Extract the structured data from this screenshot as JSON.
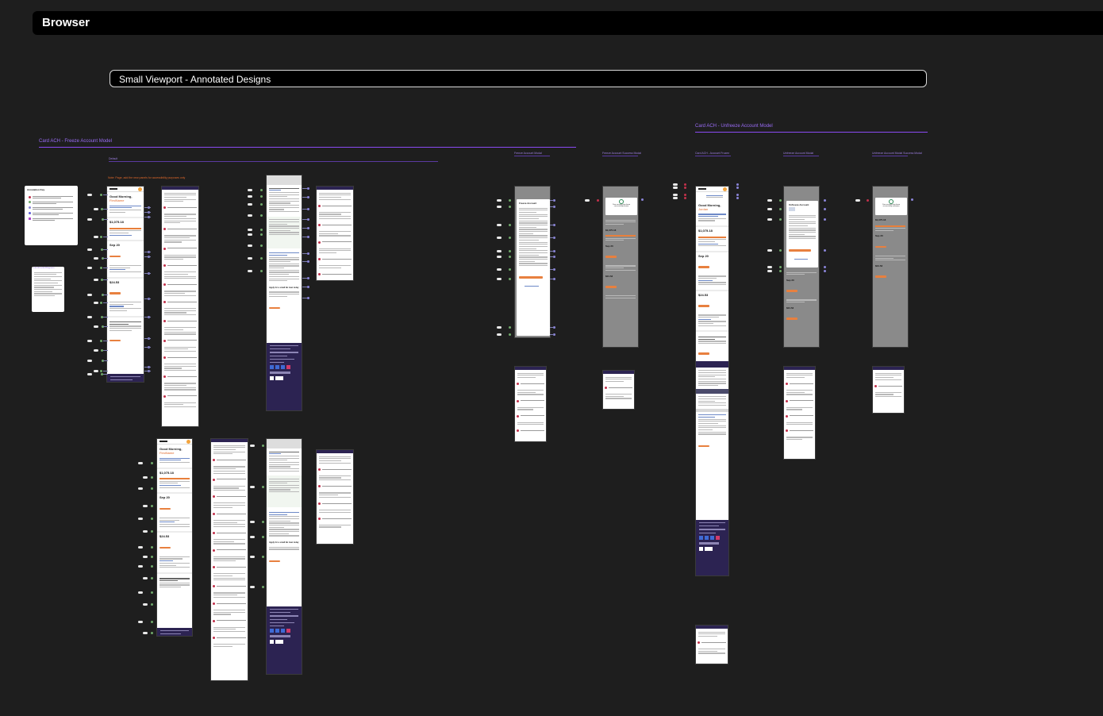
{
  "window": {
    "title": "Browser"
  },
  "section": {
    "title": "Small Viewport - Annotated Designs"
  },
  "groups": {
    "freeze": {
      "label": "Card ACH - Freeze Account Model"
    },
    "unfreeze": {
      "label": "Card ACH - Unfreeze Account Model"
    }
  },
  "subgroups": {
    "default": "Default",
    "freeze_account": "Freeze Account Modal",
    "freeze_success": "Freeze Account Success Modal",
    "unfreeze_frozen": "Card ACH - Account Frozen",
    "unfreeze_modal": "Unfreeze Account Modal",
    "unfreeze_success": "Unfreeze Account Modal Success Modal"
  },
  "notes": {
    "orange": "Note: Page, add the new panels for accessibility purposes only",
    "legend_title": "Annotation Key",
    "landmarks_title": "Landmarks/Regions"
  },
  "mobile": {
    "greeting": "Good Morning,",
    "name_placeholder": "FirstName",
    "name_real": "Jordan",
    "balance": "$1,075.18",
    "due_date": "Sep 20",
    "min_payment": "$24.53",
    "loan_promo": "Apply for a small biz loan today",
    "savings_promo": "Open a savings account and earn up to $200*",
    "frozen_title": "Freeze Account",
    "unfrozen_title": "Unfreeze Account",
    "frozen_success": "Your account has been successfully frozen",
    "unfrozen_success": "Your account has been successfully unfrozen",
    "fdic": "FDIC",
    "app_button": "Discover Mobile App"
  },
  "colors": {
    "accent_purple": "#8a4af2",
    "brand_orange": "#e87f3b",
    "annotation_red": "#c2314b",
    "footer_navy": "#2c2352"
  }
}
